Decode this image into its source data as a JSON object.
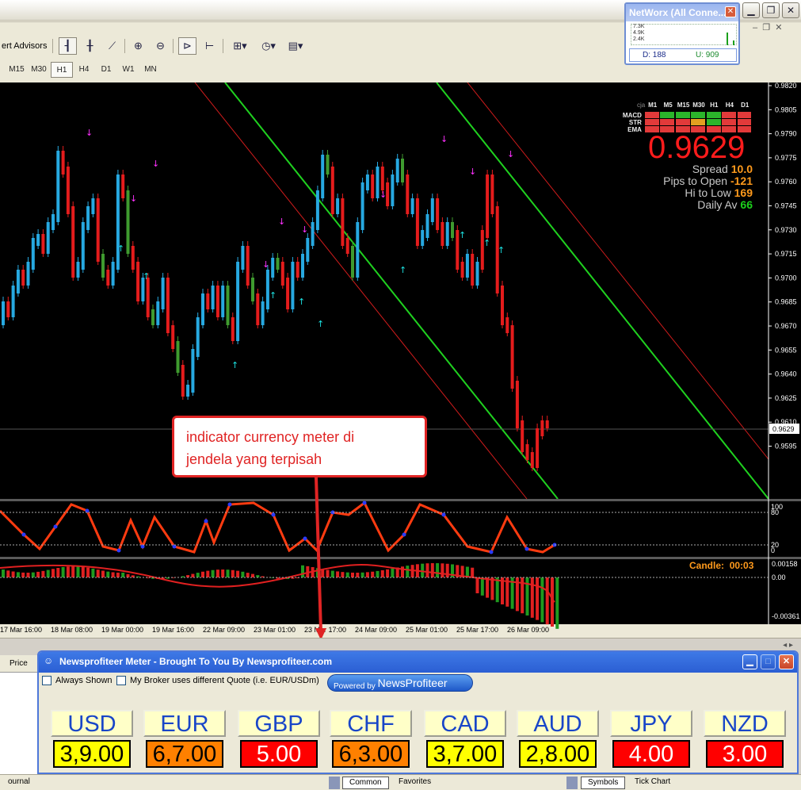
{
  "toolbar": {
    "expert_advisors_label": "ert Advisors",
    "timeframes": [
      "M15",
      "M30",
      "H1",
      "H4",
      "D1",
      "W1",
      "MN"
    ],
    "active_timeframe": "H1"
  },
  "networx": {
    "title": "NetWorx (All Conne...",
    "graph_labels": [
      "7.3K",
      "4.9K",
      "2.4K"
    ],
    "download": "D: 188",
    "upload": "U: 909"
  },
  "chart": {
    "price_scale": [
      "0.9820",
      "0.9805",
      "0.9790",
      "0.9775",
      "0.9760",
      "0.9745",
      "0.9730",
      "0.9715",
      "0.9700",
      "0.9685",
      "0.9670",
      "0.9655",
      "0.9640",
      "0.9625",
      "0.9610",
      "0.9595"
    ],
    "current_price_tag": "0.9629",
    "stoch_scale": [
      "100",
      "80",
      "20",
      "0"
    ],
    "macd_scale": [
      "0.00158",
      "0.00",
      "-0.00361"
    ],
    "time_axis": [
      "17 Mar 16:00",
      "18 Mar 08:00",
      "19 Mar 00:00",
      "19 Mar 16:00",
      "22 Mar 09:00",
      "23 Mar 01:00",
      "23 Mar 17:00",
      "24 Mar 09:00",
      "25 Mar 01:00",
      "25 Mar 17:00",
      "26 Mar 09:00"
    ],
    "candle_label": "Candle:",
    "candle_time": "00:03"
  },
  "dashboard": {
    "corner_label": "cja",
    "timeframes": [
      "M1",
      "M5",
      "M15",
      "M30",
      "H1",
      "H4",
      "D1"
    ],
    "rows": [
      {
        "label": "MACD",
        "colors": [
          "#e23a3a",
          "#2bb52b",
          "#2bb52b",
          "#2bb52b",
          "#2bb52b",
          "#e23a3a",
          "#e23a3a"
        ]
      },
      {
        "label": "STR",
        "colors": [
          "#e23a3a",
          "#e23a3a",
          "#e23a3a",
          "#e2a020",
          "#2bb52b",
          "#e23a3a",
          "#e23a3a"
        ]
      },
      {
        "label": "EMA",
        "colors": [
          "#e23a3a",
          "#e23a3a",
          "#e23a3a",
          "#e23a3a",
          "#e23a3a",
          "#e23a3a",
          "#e23a3a"
        ]
      }
    ],
    "big_price": "0.9629",
    "spread_label": "Spread",
    "spread_value": "10.0",
    "pips_label": "Pips to Open",
    "pips_value": "-121",
    "hilo_label": "Hi to Low",
    "hilo_value": "169",
    "daily_label": "Daily Av",
    "daily_value": "66"
  },
  "callout": {
    "line1": "indicator currency meter di",
    "line2": "jendela yang terpisah"
  },
  "left_panel": {
    "price_header": "Price"
  },
  "meter": {
    "title": "Newsprofiteer Meter - Brought To You By Newsprofiteer.com",
    "always_shown": "Always Shown",
    "broker_quote": "My Broker uses different Quote (i.e. EUR/USDm)",
    "powered_by": "Powered by",
    "brand": "NewsProfiteer",
    "currencies": [
      {
        "code": "USD",
        "value": "3,9.00",
        "color": "#ffff00"
      },
      {
        "code": "EUR",
        "value": "6,7.00",
        "color": "#ff8000"
      },
      {
        "code": "GBP",
        "value": "5.00",
        "color": "#ff0000"
      },
      {
        "code": "CHF",
        "value": "6,3.00",
        "color": "#ff8000"
      },
      {
        "code": "CAD",
        "value": "3,7.00",
        "color": "#ffff00"
      },
      {
        "code": "AUD",
        "value": "2,8.00",
        "color": "#ffff00"
      },
      {
        "code": "JPY",
        "value": "4.00",
        "color": "#ff0000"
      },
      {
        "code": "NZD",
        "value": "3.00",
        "color": "#ff0000"
      }
    ]
  },
  "status": {
    "journal": "ournal",
    "common": "Common",
    "favorites": "Favorites",
    "symbols": "Symbols",
    "tick_chart": "Tick Chart"
  }
}
